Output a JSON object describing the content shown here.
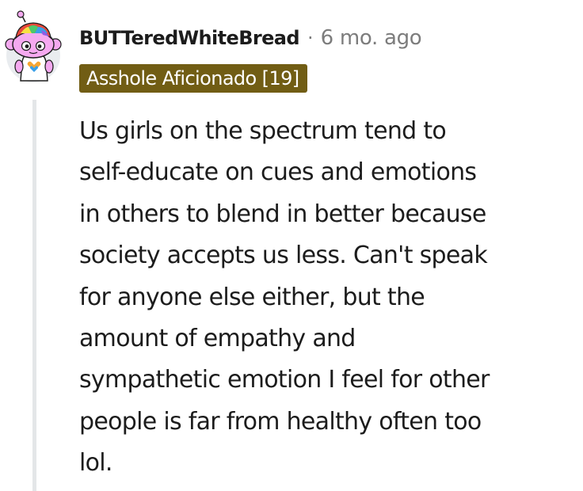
{
  "comment": {
    "username": "BUTTeredWhiteBread",
    "separator": "·",
    "timestamp": "6 mo. ago",
    "flair": "Asshole Aficionado [19]",
    "body": "Us girls on the spectrum tend to\nself-educate on cues and emotions\nin others to blend in better because\nsociety accepts us less. Can't speak\nfor anyone else either, but the\namount of empathy and\nsympathetic emotion I feel for other\npeople is far from healthy often too\nlol."
  },
  "avatar": {
    "icon": "snoo-avatar-icon",
    "background_color": "#e9ecef",
    "body_color": "#f5a9f0",
    "hair_colors": [
      "#e8483a",
      "#f7a531",
      "#f6e042",
      "#4cc96a",
      "#3aa0e8",
      "#8e5ce8"
    ]
  },
  "colors": {
    "text": "#1c1c1c",
    "meta": "#7c7c7c",
    "flair_background": "#715d14",
    "flair_text": "#ffffff",
    "thread_line": "#e4e6e8"
  }
}
